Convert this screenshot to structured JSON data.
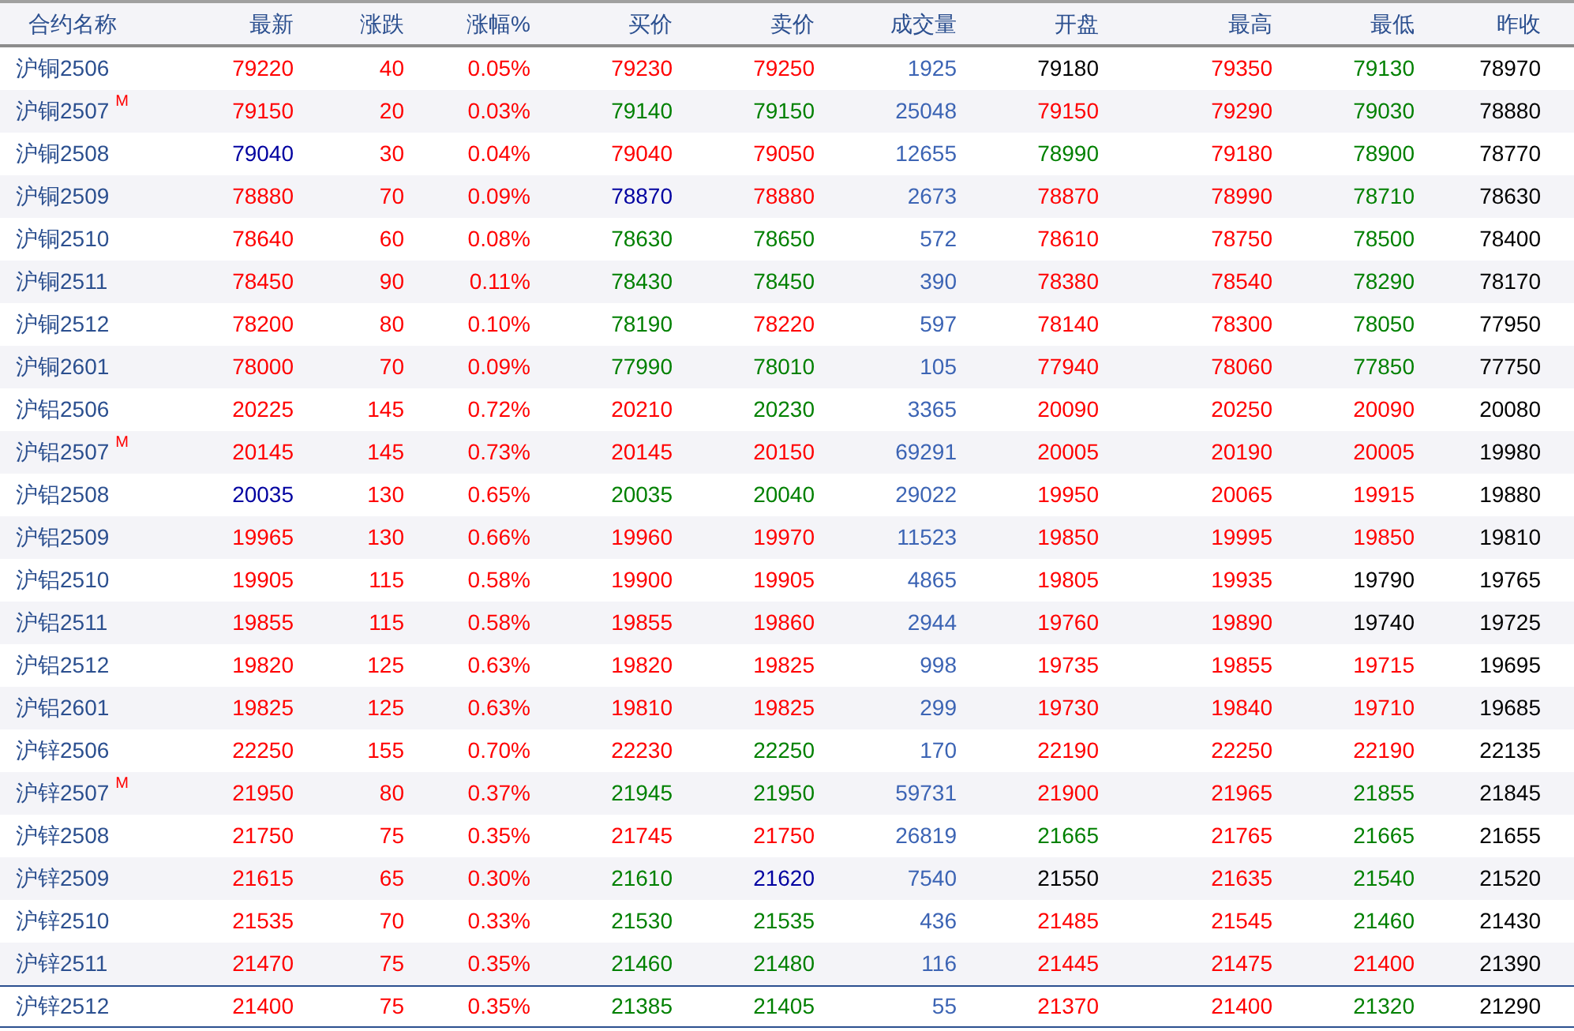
{
  "table": {
    "columns": [
      "合约名称",
      "最新",
      "涨跌",
      "涨幅%",
      "买价",
      "卖价",
      "成交量",
      "开盘",
      "最高",
      "最低",
      "昨收"
    ],
    "rows": [
      {
        "selected": false,
        "cells": [
          {
            "text": "沪铜2506"
          },
          {
            "text": "79220",
            "color": "#ff0000"
          },
          {
            "text": "40",
            "color": "#ff0000"
          },
          {
            "text": "0.05%",
            "color": "#ff0000"
          },
          {
            "text": "79230",
            "color": "#ff0000"
          },
          {
            "text": "79250",
            "color": "#ff0000"
          },
          {
            "text": "1925"
          },
          {
            "text": "79180",
            "color": "#000000"
          },
          {
            "text": "79350",
            "color": "#ff0000"
          },
          {
            "text": "79130",
            "color": "#008000"
          },
          {
            "text": "78970"
          }
        ]
      },
      {
        "selected": false,
        "cells": [
          {
            "text": "沪铜2507",
            "tag": "M"
          },
          {
            "text": "79150",
            "color": "#ff0000"
          },
          {
            "text": "20",
            "color": "#ff0000"
          },
          {
            "text": "0.03%",
            "color": "#ff0000"
          },
          {
            "text": "79140",
            "color": "#008000"
          },
          {
            "text": "79150",
            "color": "#008000"
          },
          {
            "text": "25048"
          },
          {
            "text": "79150",
            "color": "#ff0000"
          },
          {
            "text": "79290",
            "color": "#ff0000"
          },
          {
            "text": "79030",
            "color": "#008000"
          },
          {
            "text": "78880"
          }
        ]
      },
      {
        "selected": false,
        "cells": [
          {
            "text": "沪铜2508"
          },
          {
            "text": "79040",
            "color": "#0000a0"
          },
          {
            "text": "30",
            "color": "#ff0000"
          },
          {
            "text": "0.04%",
            "color": "#ff0000"
          },
          {
            "text": "79040",
            "color": "#ff0000"
          },
          {
            "text": "79050",
            "color": "#ff0000"
          },
          {
            "text": "12655"
          },
          {
            "text": "78990",
            "color": "#008000"
          },
          {
            "text": "79180",
            "color": "#ff0000"
          },
          {
            "text": "78900",
            "color": "#008000"
          },
          {
            "text": "78770"
          }
        ]
      },
      {
        "selected": false,
        "cells": [
          {
            "text": "沪铜2509"
          },
          {
            "text": "78880",
            "color": "#ff0000"
          },
          {
            "text": "70",
            "color": "#ff0000"
          },
          {
            "text": "0.09%",
            "color": "#ff0000"
          },
          {
            "text": "78870",
            "color": "#0000a0"
          },
          {
            "text": "78880",
            "color": "#ff0000"
          },
          {
            "text": "2673"
          },
          {
            "text": "78870",
            "color": "#ff0000"
          },
          {
            "text": "78990",
            "color": "#ff0000"
          },
          {
            "text": "78710",
            "color": "#008000"
          },
          {
            "text": "78630"
          }
        ]
      },
      {
        "selected": false,
        "cells": [
          {
            "text": "沪铜2510"
          },
          {
            "text": "78640",
            "color": "#ff0000"
          },
          {
            "text": "60",
            "color": "#ff0000"
          },
          {
            "text": "0.08%",
            "color": "#ff0000"
          },
          {
            "text": "78630",
            "color": "#008000"
          },
          {
            "text": "78650",
            "color": "#008000"
          },
          {
            "text": "572"
          },
          {
            "text": "78610",
            "color": "#ff0000"
          },
          {
            "text": "78750",
            "color": "#ff0000"
          },
          {
            "text": "78500",
            "color": "#008000"
          },
          {
            "text": "78400"
          }
        ]
      },
      {
        "selected": false,
        "cells": [
          {
            "text": "沪铜2511"
          },
          {
            "text": "78450",
            "color": "#ff0000"
          },
          {
            "text": "90",
            "color": "#ff0000"
          },
          {
            "text": "0.11%",
            "color": "#ff0000"
          },
          {
            "text": "78430",
            "color": "#008000"
          },
          {
            "text": "78450",
            "color": "#008000"
          },
          {
            "text": "390"
          },
          {
            "text": "78380",
            "color": "#ff0000"
          },
          {
            "text": "78540",
            "color": "#ff0000"
          },
          {
            "text": "78290",
            "color": "#008000"
          },
          {
            "text": "78170"
          }
        ]
      },
      {
        "selected": false,
        "cells": [
          {
            "text": "沪铜2512"
          },
          {
            "text": "78200",
            "color": "#ff0000"
          },
          {
            "text": "80",
            "color": "#ff0000"
          },
          {
            "text": "0.10%",
            "color": "#ff0000"
          },
          {
            "text": "78190",
            "color": "#008000"
          },
          {
            "text": "78220",
            "color": "#ff0000"
          },
          {
            "text": "597"
          },
          {
            "text": "78140",
            "color": "#ff0000"
          },
          {
            "text": "78300",
            "color": "#ff0000"
          },
          {
            "text": "78050",
            "color": "#008000"
          },
          {
            "text": "77950"
          }
        ]
      },
      {
        "selected": false,
        "cells": [
          {
            "text": "沪铜2601"
          },
          {
            "text": "78000",
            "color": "#ff0000"
          },
          {
            "text": "70",
            "color": "#ff0000"
          },
          {
            "text": "0.09%",
            "color": "#ff0000"
          },
          {
            "text": "77990",
            "color": "#008000"
          },
          {
            "text": "78010",
            "color": "#008000"
          },
          {
            "text": "105"
          },
          {
            "text": "77940",
            "color": "#ff0000"
          },
          {
            "text": "78060",
            "color": "#ff0000"
          },
          {
            "text": "77850",
            "color": "#008000"
          },
          {
            "text": "77750"
          }
        ]
      },
      {
        "selected": false,
        "cells": [
          {
            "text": "沪铝2506"
          },
          {
            "text": "20225",
            "color": "#ff0000"
          },
          {
            "text": "145",
            "color": "#ff0000"
          },
          {
            "text": "0.72%",
            "color": "#ff0000"
          },
          {
            "text": "20210",
            "color": "#ff0000"
          },
          {
            "text": "20230",
            "color": "#008000"
          },
          {
            "text": "3365"
          },
          {
            "text": "20090",
            "color": "#ff0000"
          },
          {
            "text": "20250",
            "color": "#ff0000"
          },
          {
            "text": "20090",
            "color": "#ff0000"
          },
          {
            "text": "20080"
          }
        ]
      },
      {
        "selected": false,
        "cells": [
          {
            "text": "沪铝2507",
            "tag": "M"
          },
          {
            "text": "20145",
            "color": "#ff0000"
          },
          {
            "text": "145",
            "color": "#ff0000"
          },
          {
            "text": "0.73%",
            "color": "#ff0000"
          },
          {
            "text": "20145",
            "color": "#ff0000"
          },
          {
            "text": "20150",
            "color": "#ff0000"
          },
          {
            "text": "69291"
          },
          {
            "text": "20005",
            "color": "#ff0000"
          },
          {
            "text": "20190",
            "color": "#ff0000"
          },
          {
            "text": "20005",
            "color": "#ff0000"
          },
          {
            "text": "19980"
          }
        ]
      },
      {
        "selected": false,
        "cells": [
          {
            "text": "沪铝2508"
          },
          {
            "text": "20035",
            "color": "#0000a0"
          },
          {
            "text": "130",
            "color": "#ff0000"
          },
          {
            "text": "0.65%",
            "color": "#ff0000"
          },
          {
            "text": "20035",
            "color": "#008000"
          },
          {
            "text": "20040",
            "color": "#008000"
          },
          {
            "text": "29022"
          },
          {
            "text": "19950",
            "color": "#ff0000"
          },
          {
            "text": "20065",
            "color": "#ff0000"
          },
          {
            "text": "19915",
            "color": "#ff0000"
          },
          {
            "text": "19880"
          }
        ]
      },
      {
        "selected": false,
        "cells": [
          {
            "text": "沪铝2509"
          },
          {
            "text": "19965",
            "color": "#ff0000"
          },
          {
            "text": "130",
            "color": "#ff0000"
          },
          {
            "text": "0.66%",
            "color": "#ff0000"
          },
          {
            "text": "19960",
            "color": "#ff0000"
          },
          {
            "text": "19970",
            "color": "#ff0000"
          },
          {
            "text": "11523"
          },
          {
            "text": "19850",
            "color": "#ff0000"
          },
          {
            "text": "19995",
            "color": "#ff0000"
          },
          {
            "text": "19850",
            "color": "#ff0000"
          },
          {
            "text": "19810"
          }
        ]
      },
      {
        "selected": false,
        "cells": [
          {
            "text": "沪铝2510"
          },
          {
            "text": "19905",
            "color": "#ff0000"
          },
          {
            "text": "115",
            "color": "#ff0000"
          },
          {
            "text": "0.58%",
            "color": "#ff0000"
          },
          {
            "text": "19900",
            "color": "#ff0000"
          },
          {
            "text": "19905",
            "color": "#ff0000"
          },
          {
            "text": "4865"
          },
          {
            "text": "19805",
            "color": "#ff0000"
          },
          {
            "text": "19935",
            "color": "#ff0000"
          },
          {
            "text": "19790",
            "color": "#000000"
          },
          {
            "text": "19765"
          }
        ]
      },
      {
        "selected": false,
        "cells": [
          {
            "text": "沪铝2511"
          },
          {
            "text": "19855",
            "color": "#ff0000"
          },
          {
            "text": "115",
            "color": "#ff0000"
          },
          {
            "text": "0.58%",
            "color": "#ff0000"
          },
          {
            "text": "19855",
            "color": "#ff0000"
          },
          {
            "text": "19860",
            "color": "#ff0000"
          },
          {
            "text": "2944"
          },
          {
            "text": "19760",
            "color": "#ff0000"
          },
          {
            "text": "19890",
            "color": "#ff0000"
          },
          {
            "text": "19740",
            "color": "#000000"
          },
          {
            "text": "19725"
          }
        ]
      },
      {
        "selected": false,
        "cells": [
          {
            "text": "沪铝2512"
          },
          {
            "text": "19820",
            "color": "#ff0000"
          },
          {
            "text": "125",
            "color": "#ff0000"
          },
          {
            "text": "0.63%",
            "color": "#ff0000"
          },
          {
            "text": "19820",
            "color": "#ff0000"
          },
          {
            "text": "19825",
            "color": "#ff0000"
          },
          {
            "text": "998"
          },
          {
            "text": "19735",
            "color": "#ff0000"
          },
          {
            "text": "19855",
            "color": "#ff0000"
          },
          {
            "text": "19715",
            "color": "#ff0000"
          },
          {
            "text": "19695"
          }
        ]
      },
      {
        "selected": false,
        "cells": [
          {
            "text": "沪铝2601"
          },
          {
            "text": "19825",
            "color": "#ff0000"
          },
          {
            "text": "125",
            "color": "#ff0000"
          },
          {
            "text": "0.63%",
            "color": "#ff0000"
          },
          {
            "text": "19810",
            "color": "#ff0000"
          },
          {
            "text": "19825",
            "color": "#ff0000"
          },
          {
            "text": "299"
          },
          {
            "text": "19730",
            "color": "#ff0000"
          },
          {
            "text": "19840",
            "color": "#ff0000"
          },
          {
            "text": "19710",
            "color": "#ff0000"
          },
          {
            "text": "19685"
          }
        ]
      },
      {
        "selected": false,
        "cells": [
          {
            "text": "沪锌2506"
          },
          {
            "text": "22250",
            "color": "#ff0000"
          },
          {
            "text": "155",
            "color": "#ff0000"
          },
          {
            "text": "0.70%",
            "color": "#ff0000"
          },
          {
            "text": "22230",
            "color": "#ff0000"
          },
          {
            "text": "22250",
            "color": "#008000"
          },
          {
            "text": "170"
          },
          {
            "text": "22190",
            "color": "#ff0000"
          },
          {
            "text": "22250",
            "color": "#ff0000"
          },
          {
            "text": "22190",
            "color": "#ff0000"
          },
          {
            "text": "22135"
          }
        ]
      },
      {
        "selected": false,
        "cells": [
          {
            "text": "沪锌2507",
            "tag": "M"
          },
          {
            "text": "21950",
            "color": "#ff0000"
          },
          {
            "text": "80",
            "color": "#ff0000"
          },
          {
            "text": "0.37%",
            "color": "#ff0000"
          },
          {
            "text": "21945",
            "color": "#008000"
          },
          {
            "text": "21950",
            "color": "#008000"
          },
          {
            "text": "59731"
          },
          {
            "text": "21900",
            "color": "#ff0000"
          },
          {
            "text": "21965",
            "color": "#ff0000"
          },
          {
            "text": "21855",
            "color": "#008000"
          },
          {
            "text": "21845"
          }
        ]
      },
      {
        "selected": false,
        "cells": [
          {
            "text": "沪锌2508"
          },
          {
            "text": "21750",
            "color": "#ff0000"
          },
          {
            "text": "75",
            "color": "#ff0000"
          },
          {
            "text": "0.35%",
            "color": "#ff0000"
          },
          {
            "text": "21745",
            "color": "#ff0000"
          },
          {
            "text": "21750",
            "color": "#ff0000"
          },
          {
            "text": "26819"
          },
          {
            "text": "21665",
            "color": "#008000"
          },
          {
            "text": "21765",
            "color": "#ff0000"
          },
          {
            "text": "21665",
            "color": "#008000"
          },
          {
            "text": "21655"
          }
        ]
      },
      {
        "selected": false,
        "cells": [
          {
            "text": "沪锌2509"
          },
          {
            "text": "21615",
            "color": "#ff0000"
          },
          {
            "text": "65",
            "color": "#ff0000"
          },
          {
            "text": "0.30%",
            "color": "#ff0000"
          },
          {
            "text": "21610",
            "color": "#008000"
          },
          {
            "text": "21620",
            "color": "#0000a0"
          },
          {
            "text": "7540"
          },
          {
            "text": "21550",
            "color": "#000000"
          },
          {
            "text": "21635",
            "color": "#ff0000"
          },
          {
            "text": "21540",
            "color": "#008000"
          },
          {
            "text": "21520"
          }
        ]
      },
      {
        "selected": false,
        "cells": [
          {
            "text": "沪锌2510"
          },
          {
            "text": "21535",
            "color": "#ff0000"
          },
          {
            "text": "70",
            "color": "#ff0000"
          },
          {
            "text": "0.33%",
            "color": "#ff0000"
          },
          {
            "text": "21530",
            "color": "#008000"
          },
          {
            "text": "21535",
            "color": "#008000"
          },
          {
            "text": "436"
          },
          {
            "text": "21485",
            "color": "#ff0000"
          },
          {
            "text": "21545",
            "color": "#ff0000"
          },
          {
            "text": "21460",
            "color": "#008000"
          },
          {
            "text": "21430"
          }
        ]
      },
      {
        "selected": false,
        "cells": [
          {
            "text": "沪锌2511"
          },
          {
            "text": "21470",
            "color": "#ff0000"
          },
          {
            "text": "75",
            "color": "#ff0000"
          },
          {
            "text": "0.35%",
            "color": "#ff0000"
          },
          {
            "text": "21460",
            "color": "#008000"
          },
          {
            "text": "21480",
            "color": "#008000"
          },
          {
            "text": "116"
          },
          {
            "text": "21445",
            "color": "#ff0000"
          },
          {
            "text": "21475",
            "color": "#ff0000"
          },
          {
            "text": "21400",
            "color": "#ff0000"
          },
          {
            "text": "21390"
          }
        ]
      },
      {
        "selected": true,
        "cells": [
          {
            "text": "沪锌2512"
          },
          {
            "text": "21400",
            "color": "#ff0000"
          },
          {
            "text": "75",
            "color": "#ff0000"
          },
          {
            "text": "0.35%",
            "color": "#ff0000"
          },
          {
            "text": "21385",
            "color": "#008000"
          },
          {
            "text": "21405",
            "color": "#008000"
          },
          {
            "text": "55"
          },
          {
            "text": "21370",
            "color": "#ff0000"
          },
          {
            "text": "21400",
            "color": "#ff0000"
          },
          {
            "text": "21320",
            "color": "#008000"
          },
          {
            "text": "21290"
          }
        ]
      }
    ]
  }
}
